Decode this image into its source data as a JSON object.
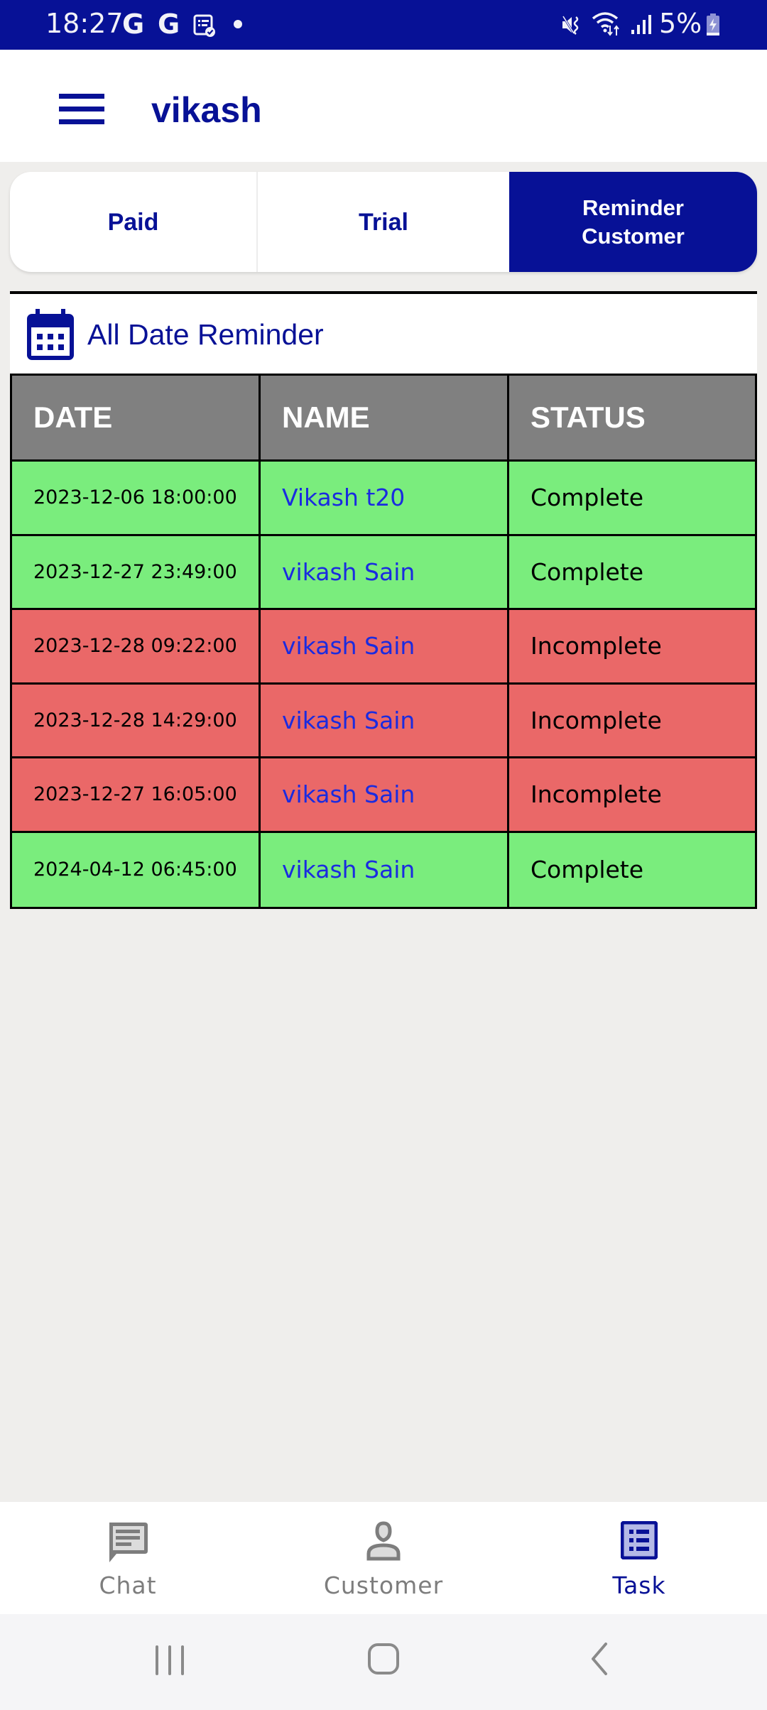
{
  "status_bar": {
    "time": "18:27",
    "left_icons": [
      "google-g-icon",
      "google-g-icon",
      "task-checked-icon",
      "notification-dot-icon"
    ],
    "right_icons": [
      "mute-vibrate-icon",
      "wifi-data-icon",
      "signal-icon"
    ],
    "battery_percent": "5%",
    "battery_state": "charging"
  },
  "app_bar": {
    "menu_icon": "hamburger-menu-icon",
    "title": "vikash"
  },
  "tabs": [
    {
      "label": "Paid",
      "active": false
    },
    {
      "label": "Trial",
      "active": false
    },
    {
      "label": "Reminder Customer",
      "active": true
    }
  ],
  "reminder_panel": {
    "icon": "calendar-icon",
    "title": "All Date Reminder"
  },
  "table": {
    "columns": [
      "DATE",
      "NAME",
      "STATUS"
    ],
    "rows": [
      {
        "date": "2023-12-06 18:00:00",
        "name": "Vikash t20",
        "status": "Complete"
      },
      {
        "date": "2023-12-27 23:49:00",
        "name": "vikash Sain",
        "status": "Complete"
      },
      {
        "date": "2023-12-28 09:22:00",
        "name": "vikash Sain",
        "status": "Incomplete"
      },
      {
        "date": "2023-12-28 14:29:00",
        "name": "vikash Sain",
        "status": "Incomplete"
      },
      {
        "date": "2023-12-27 16:05:00",
        "name": "vikash Sain",
        "status": "Incomplete"
      },
      {
        "date": "2024-04-12 06:45:00",
        "name": "vikash Sain",
        "status": "Complete"
      }
    ],
    "status_colors": {
      "Complete": "#7aed7d",
      "Incomplete": "#ea6868"
    }
  },
  "bottom_nav": [
    {
      "label": "Chat",
      "icon": "chat-icon",
      "active": false
    },
    {
      "label": "Customer",
      "icon": "person-icon",
      "active": false
    },
    {
      "label": "Task",
      "icon": "task-list-icon",
      "active": true
    }
  ],
  "system_nav": {
    "recents": "recents-icon",
    "home": "home-icon",
    "back": "back-icon"
  },
  "colors": {
    "brand": "#071196",
    "header_gray": "#808080",
    "name_link": "#1a2be0"
  }
}
